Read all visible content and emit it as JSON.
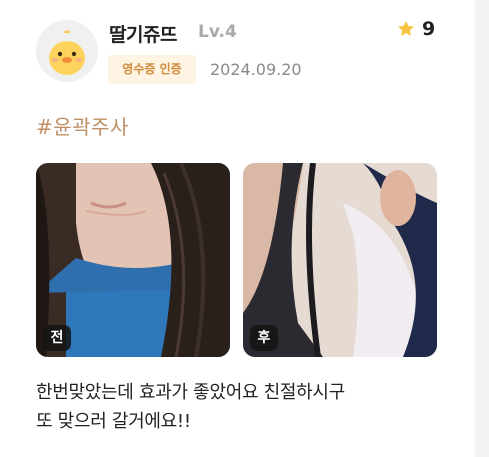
{
  "review_card": {
    "user": {
      "avatar_icon": "duck-avatar-icon",
      "username": "딸기쥬뜨",
      "level": "Lv.4",
      "receipt_badge": "영수증 인증",
      "date": "2024.09.20"
    },
    "rating": {
      "icon": "star-icon",
      "value": "9",
      "star_color": "#f7c343"
    },
    "hashtag": "#윤곽주사",
    "photos": [
      {
        "label": "전",
        "description_icon": "before-photo"
      },
      {
        "label": "후",
        "description_icon": "after-photo"
      }
    ],
    "review_lines": [
      "한번맞았는데 효과가 좋았어요 친절하시구",
      "또 맞으러 갈거에요!!"
    ],
    "colors": {
      "hashtag": "#bf8f66",
      "badge_bg": "#fff3e3",
      "badge_text": "#cf8a3a",
      "level": "#a9a9a9"
    }
  }
}
